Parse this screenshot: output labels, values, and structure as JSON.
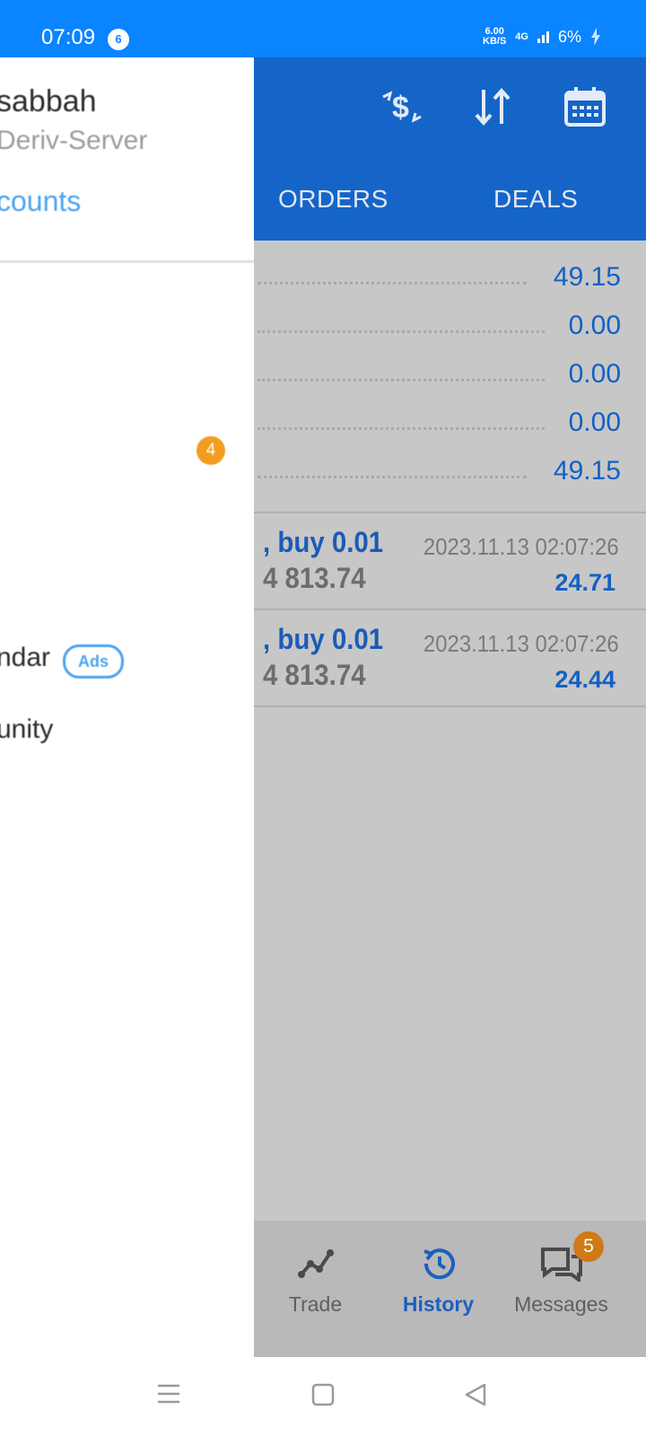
{
  "status_bar": {
    "time": "07:09",
    "notification_count": "6",
    "speed_value": "6.00",
    "speed_unit": "KB/S",
    "network": "4G",
    "battery": "6%"
  },
  "drawer": {
    "account_name": "sabbah",
    "server": "Deriv-Server",
    "manage_accounts_link": "counts",
    "menu_badge": "4",
    "calendar_item": "ndar",
    "ads_badge": "Ads",
    "community_item": "unity"
  },
  "toolbar": {
    "icons": [
      "currency-exchange-icon",
      "sort-icon",
      "calendar-icon"
    ]
  },
  "tabs": {
    "orders": "ORDERS",
    "deals": "DEALS"
  },
  "summary": {
    "values": [
      "49.15",
      "0.00",
      "0.00",
      "0.00",
      "49.15"
    ]
  },
  "deals": [
    {
      "action": ", buy 0.01",
      "price": "4 813.74",
      "time": "2023.11.13 02:07:26",
      "profit": "24.71"
    },
    {
      "action": ", buy 0.01",
      "price": "4 813.74",
      "time": "2023.11.13 02:07:26",
      "profit": "24.44"
    }
  ],
  "bottom_nav": {
    "trade": "Trade",
    "history": "History",
    "messages": "Messages",
    "messages_badge": "5"
  },
  "colors": {
    "status_bar": "#0a84ff",
    "toolbar": "#1565c9",
    "accent_text": "#1460c4",
    "dim_overlay": "#c7c7c7",
    "badge_orange": "#f29d1f"
  }
}
